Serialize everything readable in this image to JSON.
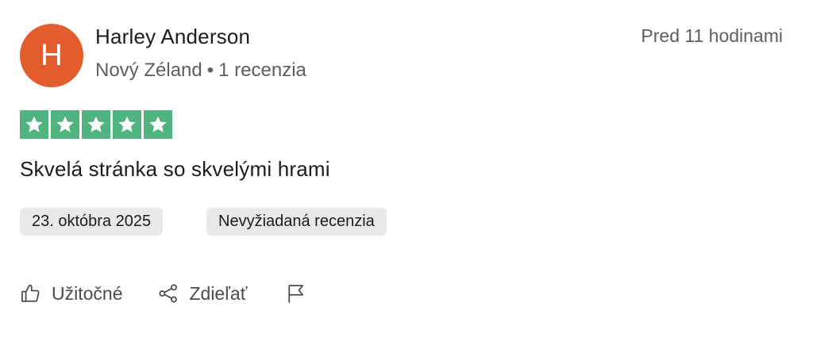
{
  "reviewer": {
    "initial": "H",
    "name": "Harley Anderson",
    "country": "Nový Zéland",
    "separator": "•",
    "review_count": "1 recenzia",
    "avatar_color": "#e35c2e"
  },
  "review": {
    "time_ago": "Pred 11 hodinami",
    "rating": 5,
    "rating_max": 5,
    "star_color": "#51b37f",
    "title": "Skvelá stránka so skvelými hrami",
    "date": "23. októbra 2025",
    "status": "Nevyžiadaná recenzia"
  },
  "actions": {
    "helpful_label": "Užitočné",
    "share_label": "Zdieľať",
    "helpful_icon": "thumbs-up-icon",
    "share_icon": "share-icon",
    "flag_icon": "flag-icon"
  }
}
